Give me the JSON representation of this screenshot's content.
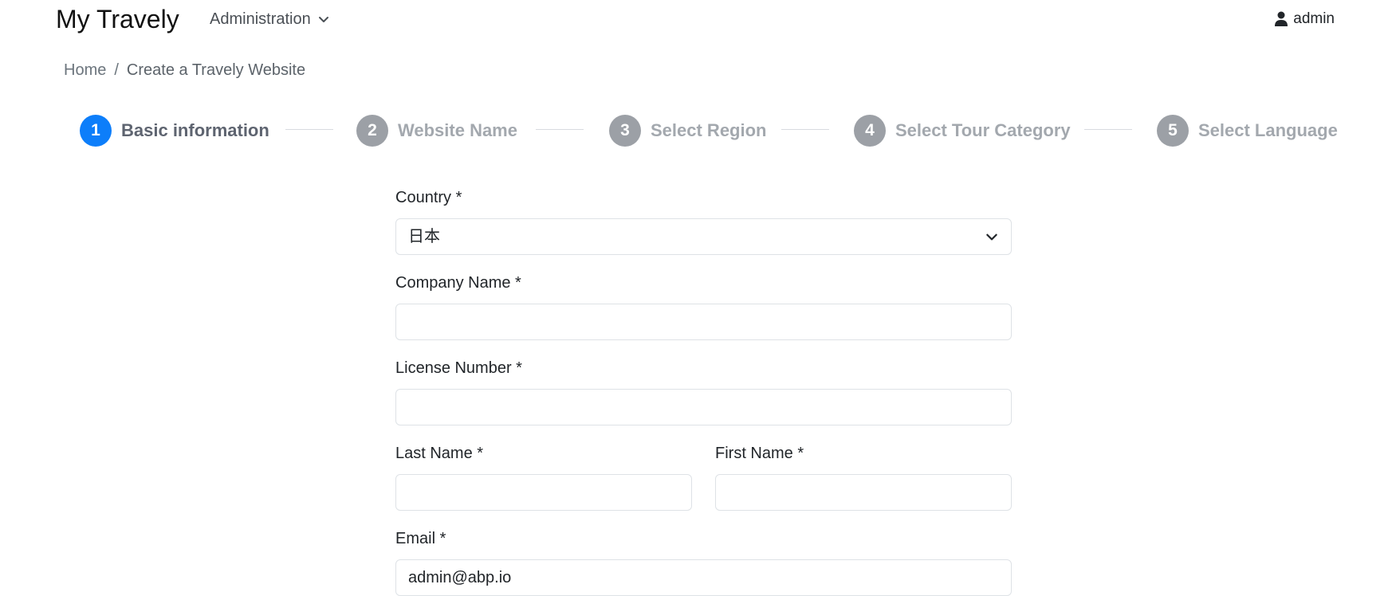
{
  "navbar": {
    "brand": "My Travely",
    "admin_menu": "Administration",
    "user": "admin"
  },
  "breadcrumb": {
    "home": "Home",
    "separator": "/",
    "current": "Create a Travely Website"
  },
  "stepper": {
    "steps": [
      {
        "number": "1",
        "label": "Basic information",
        "active": true
      },
      {
        "number": "2",
        "label": "Website Name",
        "active": false
      },
      {
        "number": "3",
        "label": "Select Region",
        "active": false
      },
      {
        "number": "4",
        "label": "Select Tour Category",
        "active": false
      },
      {
        "number": "5",
        "label": "Select Language",
        "active": false
      }
    ]
  },
  "form": {
    "country_label": "Country *",
    "country_value": "日本",
    "company_label": "Company Name *",
    "company_value": "",
    "license_label": "License Number *",
    "license_value": "",
    "last_name_label": "Last Name *",
    "last_name_value": "",
    "first_name_label": "First Name *",
    "first_name_value": "",
    "email_label": "Email *",
    "email_value": "admin@abp.io"
  },
  "colors": {
    "accent": "#0d7efa",
    "inactive_step": "#9ca0a6"
  }
}
